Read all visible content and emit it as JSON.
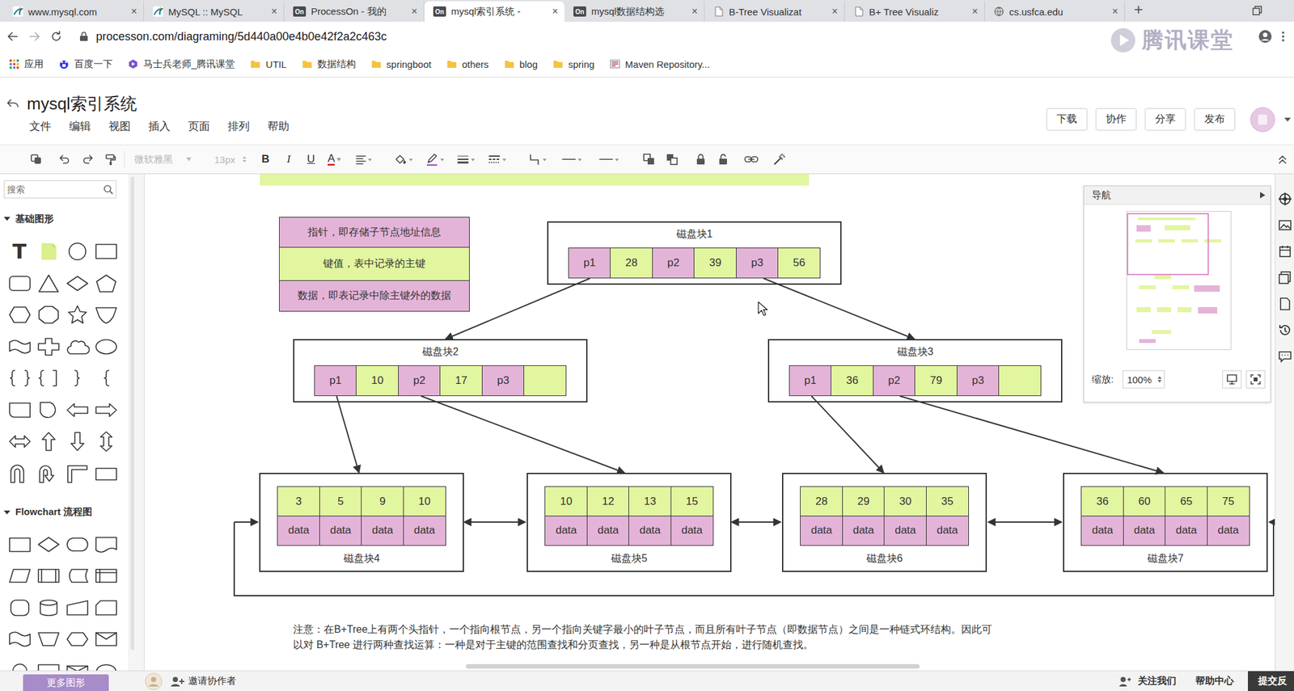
{
  "browser": {
    "tabs": [
      {
        "label": "www.mysql.com",
        "kind": "mysql",
        "selected": false
      },
      {
        "label": "MySQL :: MySQL",
        "kind": "mysql",
        "selected": false
      },
      {
        "label": "ProcessOn - 我的",
        "kind": "processon",
        "badge": "On",
        "selected": false
      },
      {
        "label": "mysql索引系统 -",
        "kind": "processon",
        "badge": "On",
        "selected": true
      },
      {
        "label": "mysql数据结构选",
        "kind": "processon",
        "badge": "On",
        "selected": false
      },
      {
        "label": "B-Tree Visualizat",
        "kind": "page",
        "selected": false
      },
      {
        "label": "B+ Tree Visualiz",
        "kind": "page",
        "selected": false
      },
      {
        "label": "cs.usfca.edu",
        "kind": "globe",
        "selected": false
      }
    ],
    "tab_close": "×",
    "new_tab": "+",
    "url": "processon.com/diagraming/5d440a00e4b0e42f2a2c463c",
    "bookmarks": [
      {
        "label": "应用",
        "kind": "apps"
      },
      {
        "label": "百度一下",
        "kind": "baidu"
      },
      {
        "label": "马士兵老师_腾讯课堂",
        "kind": "tencent"
      },
      {
        "label": "UTIL",
        "kind": "folder"
      },
      {
        "label": "数据结构",
        "kind": "folder"
      },
      {
        "label": "springboot",
        "kind": "folder"
      },
      {
        "label": "others",
        "kind": "folder"
      },
      {
        "label": "blog",
        "kind": "folder"
      },
      {
        "label": "spring",
        "kind": "folder"
      },
      {
        "label": "Maven Repository...",
        "kind": "maven"
      }
    ]
  },
  "watermark": "腾讯课堂",
  "app": {
    "title": "mysql索引系统",
    "menus": [
      "文件",
      "编辑",
      "视图",
      "插入",
      "页面",
      "排列",
      "帮助"
    ],
    "actions": [
      "下载",
      "协作",
      "分享",
      "发布"
    ]
  },
  "toolbar": {
    "font": "微软雅黑",
    "font_size": "13px",
    "disabled": true,
    "bold": "B",
    "italic": "I",
    "underline": "U",
    "font_color": "A"
  },
  "sidebar": {
    "search": {
      "placeholder": "搜索"
    },
    "sections": [
      {
        "title": "基础图形",
        "expanded": true
      },
      {
        "title": "Flowchart 流程图",
        "expanded": true
      }
    ],
    "text_shape": "T",
    "more": "更多图形"
  },
  "canvas": {
    "legend": [
      {
        "text": "指针，即存储子节点地址信息",
        "kind": "pointer"
      },
      {
        "text": "键值，表中记录的主键",
        "kind": "key"
      },
      {
        "text": "数据，即表记录中除主键外的数据",
        "kind": "data"
      }
    ],
    "inner_nodes": [
      {
        "label": "磁盘块1",
        "cells": [
          {
            "text": "p1",
            "kind": "pointer"
          },
          {
            "text": "28",
            "kind": "key"
          },
          {
            "text": "p2",
            "kind": "pointer"
          },
          {
            "text": "39",
            "kind": "key"
          },
          {
            "text": "p3",
            "kind": "pointer"
          },
          {
            "text": "56",
            "kind": "key"
          }
        ]
      },
      {
        "label": "磁盘块2",
        "cells": [
          {
            "text": "p1",
            "kind": "pointer"
          },
          {
            "text": "10",
            "kind": "key"
          },
          {
            "text": "p2",
            "kind": "pointer"
          },
          {
            "text": "17",
            "kind": "key"
          },
          {
            "text": "p3",
            "kind": "pointer"
          },
          {
            "text": "",
            "kind": "key"
          }
        ]
      },
      {
        "label": "磁盘块3",
        "cells": [
          {
            "text": "p1",
            "kind": "pointer"
          },
          {
            "text": "36",
            "kind": "key"
          },
          {
            "text": "p2",
            "kind": "pointer"
          },
          {
            "text": "79",
            "kind": "key"
          },
          {
            "text": "p3",
            "kind": "pointer"
          },
          {
            "text": "",
            "kind": "key"
          }
        ]
      }
    ],
    "leaf_nodes": [
      {
        "label": "磁盘块4",
        "keys": [
          "3",
          "5",
          "9",
          "10"
        ],
        "data": [
          "data",
          "data",
          "data",
          "data"
        ]
      },
      {
        "label": "磁盘块5",
        "keys": [
          "10",
          "12",
          "13",
          "15"
        ],
        "data": [
          "data",
          "data",
          "data",
          "data"
        ]
      },
      {
        "label": "磁盘块6",
        "keys": [
          "28",
          "29",
          "30",
          "35"
        ],
        "data": [
          "data",
          "data",
          "data",
          "data"
        ]
      },
      {
        "label": "磁盘块7",
        "keys": [
          "36",
          "60",
          "65",
          "75"
        ],
        "data": [
          "data",
          "data",
          "data",
          "data"
        ]
      }
    ],
    "note": "注意：在B+Tree上有两个头指针，一个指向根节点，另一个指向关键字最小的叶子节点，而且所有叶子节点（即数据节点）之间是一种链式环结构。因此可以对 B+Tree 进行两种查找运算：一种是对于主键的范围查找和分页查找，另一种是从根节点开始，进行随机查找。"
  },
  "navigator": {
    "title": "导航",
    "zoom_label": "缩放:",
    "zoom": "100%"
  },
  "bottom": {
    "invite": "邀请协作者",
    "links": [
      "关注我们",
      "帮助中心",
      "提交反"
    ]
  }
}
